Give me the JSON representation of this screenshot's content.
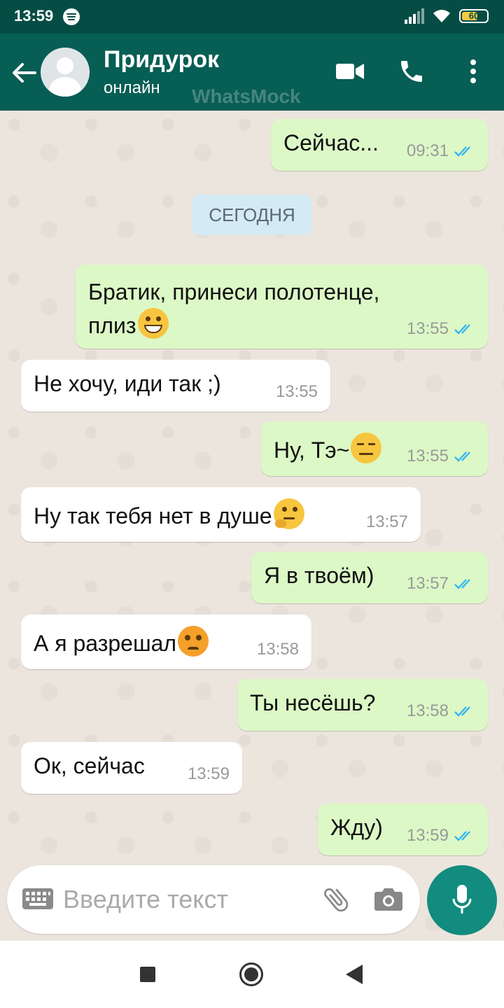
{
  "status_bar": {
    "time": "13:59",
    "battery": "60"
  },
  "header": {
    "contact_name": "Придурок",
    "presence": "онлайн",
    "watermark": "WhatsMock"
  },
  "date_chip": "СЕГОДНЯ",
  "messages": [
    {
      "direction": "out",
      "text": "Сейчас...",
      "time": "09:31",
      "read": true
    },
    {
      "direction": "out",
      "text": "Братик, принеси полотенце,",
      "text2": "плиз",
      "emoji": "grinning-face",
      "time": "13:55",
      "read": true
    },
    {
      "direction": "in",
      "text": "Не хочу, иди так ;)",
      "time": "13:55"
    },
    {
      "direction": "out",
      "text": "Ну, Тэ~",
      "emoji": "expressionless-face",
      "time": "13:55",
      "read": true
    },
    {
      "direction": "in",
      "text": "Ну так тебя нет в душе",
      "emoji": "thinking-face",
      "time": "13:57"
    },
    {
      "direction": "out",
      "text": "Я в твоём)",
      "time": "13:57",
      "read": true
    },
    {
      "direction": "in",
      "text": "А я разрешал",
      "emoji": "angry-face",
      "time": "13:58"
    },
    {
      "direction": "out",
      "text": "Ты несёшь?",
      "time": "13:58",
      "read": true
    },
    {
      "direction": "in",
      "text": "Ок, сейчас",
      "time": "13:59"
    },
    {
      "direction": "out",
      "text": "Жду)",
      "time": "13:59",
      "read": true
    }
  ],
  "composer": {
    "placeholder": "Введите текст"
  },
  "colors": {
    "header": "#075e54",
    "status_bar": "#054d44",
    "outgoing_bubble": "#dcf8c6",
    "incoming_bubble": "#ffffff",
    "read_ticks": "#34b7f1",
    "mic_button": "#128c7e"
  }
}
